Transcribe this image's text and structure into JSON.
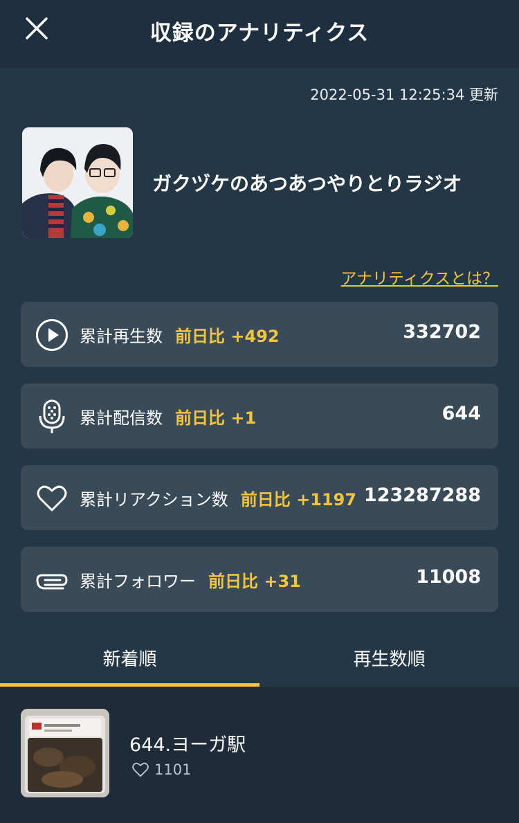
{
  "header": {
    "title": "収録のアナリティクス",
    "close_icon": "close-icon"
  },
  "updated_text": "2022-05-31 12:25:34 更新",
  "show": {
    "title": "ガクヅケのあつあつやりとりラジオ"
  },
  "about_link": "アナリティクスとは？",
  "stats": [
    {
      "icon": "play-icon",
      "label": "累計再生数",
      "diff": "前日比 +492",
      "value": "332702"
    },
    {
      "icon": "microphone-icon",
      "label": "累計配信数",
      "diff": "前日比 +1",
      "value": "644"
    },
    {
      "icon": "heart-icon",
      "label": "累計リアクション数",
      "diff": "前日比 +1197",
      "value": "123287288"
    },
    {
      "icon": "paperclip-icon",
      "label": "累計フォロワー",
      "diff": "前日比 +31",
      "value": "11008"
    }
  ],
  "tabs": [
    {
      "label": "新着順",
      "active": true
    },
    {
      "label": "再生数順",
      "active": false
    }
  ],
  "episodes": [
    {
      "title": "644.ヨーガ駅",
      "likes": "1101"
    }
  ],
  "colors": {
    "accent": "#f3c53f",
    "background": "#243747",
    "card": "#394a59"
  }
}
